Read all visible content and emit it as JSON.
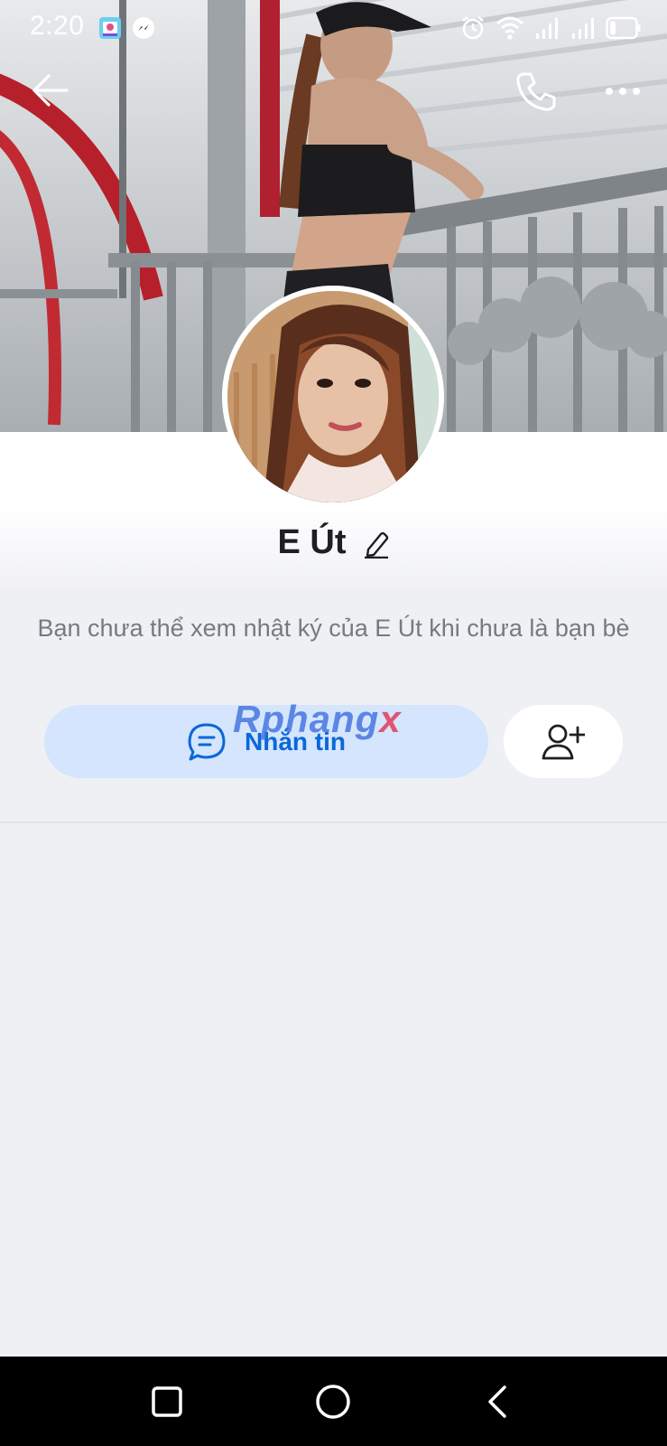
{
  "status_bar": {
    "time": "2:20",
    "icons": [
      "gallery-app-icon",
      "messenger-app-icon",
      "alarm-icon",
      "wifi-icon",
      "signal-icon",
      "signal-icon",
      "battery-icon"
    ]
  },
  "header": {
    "back_icon": "arrow-left-icon",
    "call_icon": "phone-icon",
    "more_icon": "more-dots-icon"
  },
  "profile": {
    "name": "E Út",
    "notice": "Bạn chưa thể xem nhật ký của E Út khi chưa là bạn bè"
  },
  "actions": {
    "message_label": "Nhắn tin",
    "add_friend_icon": "add-friend-icon"
  },
  "watermark": {
    "part1": "Rphang",
    "part2": "x"
  },
  "colors": {
    "accent": "#0a68d9",
    "message_button_bg": "#d4e5fd",
    "page_bg": "#eff0f4",
    "name_text": "#1e1f23",
    "muted_text": "#767a80"
  }
}
